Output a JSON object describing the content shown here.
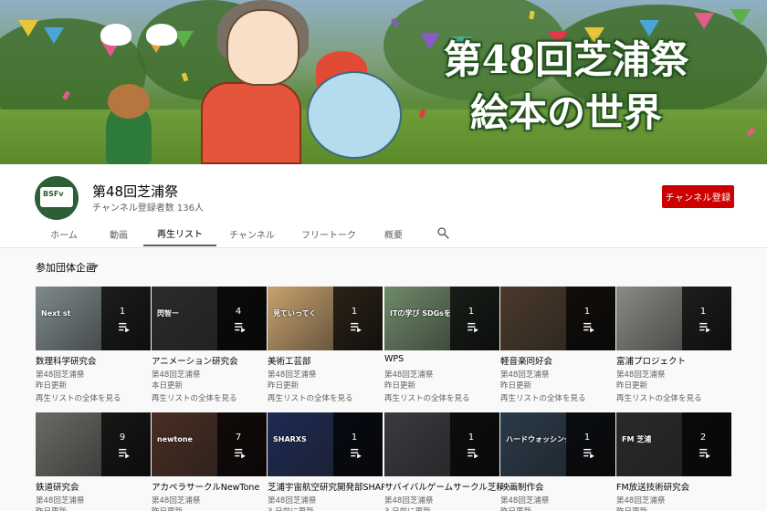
{
  "banner": {
    "title_line1": "第48回芝浦祭",
    "title_line2": "絵本の世界"
  },
  "channel": {
    "name": "第48回芝浦祭",
    "subscribers": "チャンネル登録者数 136人",
    "subscribe_label": "チャンネル登録",
    "avatar_text": "BSFv"
  },
  "tabs": [
    {
      "label": "ホーム"
    },
    {
      "label": "動画"
    },
    {
      "label": "再生リスト"
    },
    {
      "label": "チャンネル"
    },
    {
      "label": "フリートーク"
    },
    {
      "label": "概要"
    }
  ],
  "active_tab": "再生リスト",
  "section": {
    "title": "参加団体企画"
  },
  "playlists_row1": [
    {
      "title": "数理科学研究会",
      "channel": "第48回芝浦祭",
      "updated": "昨日更新",
      "view_all": "再生リストの全体を見る",
      "count": "1",
      "thumb_color": "#7f8a8c",
      "thumb_text": "Next st"
    },
    {
      "title": "アニメーション研究会",
      "channel": "第48回芝浦祭",
      "updated": "本日更新",
      "view_all": "再生リストの全体を見る",
      "count": "4",
      "thumb_color": "#2b2b2b",
      "thumb_text": "閃智ー"
    },
    {
      "title": "美術工芸部",
      "channel": "第48回芝浦祭",
      "updated": "昨日更新",
      "view_all": "再生リストの全体を見る",
      "count": "1",
      "thumb_color": "#c9a26e",
      "thumb_text": "見ていってく"
    },
    {
      "title": "WPS",
      "channel": "第48回芝浦祭",
      "updated": "昨日更新",
      "view_all": "再生リストの全体を見る",
      "count": "1",
      "thumb_color": "#6f8a6a",
      "thumb_text": "ITの学び SDGsを考"
    },
    {
      "title": "軽音楽同好会",
      "channel": "第48回芝浦祭",
      "updated": "昨日更新",
      "view_all": "再生リストの全体を見る",
      "count": "1",
      "thumb_color": "#4a3a2a",
      "thumb_text": ""
    },
    {
      "title": "富浦プロジェクト",
      "channel": "第48回芝浦祭",
      "updated": "昨日更新",
      "view_all": "再生リストの全体を見る",
      "count": "1",
      "thumb_color": "#8a8a86",
      "thumb_text": ""
    }
  ],
  "playlists_row2": [
    {
      "title": "鉄道研究会",
      "channel": "第48回芝浦祭",
      "updated": "昨日更新",
      "count": "9",
      "thumb_color": "#6b6a66",
      "thumb_text": ""
    },
    {
      "title": "アカペラサークルNewTone",
      "channel": "第48回芝浦祭",
      "updated": "昨日更新",
      "count": "7",
      "thumb_color": "#4a2d22",
      "thumb_text": "newtone"
    },
    {
      "title": "芝浦宇宙航空研究開発部SHARXS",
      "channel": "第48回芝浦祭",
      "updated": "3 日前に更新",
      "count": "1",
      "thumb_color": "#1d2a55",
      "thumb_text": "SHARXS"
    },
    {
      "title": "サバイバルゲームサークル芝精",
      "channel": "第48回芝浦祭",
      "updated": "3 日前に更新",
      "count": "1",
      "thumb_color": "#3a3a40",
      "thumb_text": ""
    },
    {
      "title": "映画制作会",
      "channel": "第48回芝浦祭",
      "updated": "昨日更新",
      "count": "1",
      "thumb_color": "#2a3a4a",
      "thumb_text": "ハードウォッシング"
    },
    {
      "title": "FM放送技術研究会",
      "channel": "第48回芝浦祭",
      "updated": "昨日更新",
      "count": "2",
      "thumb_color": "#2a2a2a",
      "thumb_text": "FM 芝浦"
    }
  ],
  "colors": {
    "accent_red": "#cc0000",
    "text_primary": "#030303",
    "text_secondary": "#606060",
    "page_bg": "#f9f9f9"
  }
}
